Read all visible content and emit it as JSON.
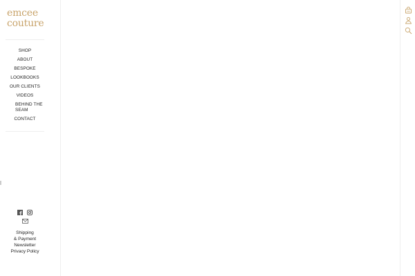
{
  "brand": {
    "line1": "emcee",
    "line2": "couture",
    "color": "#c8a36a"
  },
  "nav": {
    "items": [
      {
        "label": "SHOP"
      },
      {
        "label": "ABOUT"
      },
      {
        "label": "BESPOKE"
      },
      {
        "label": "LOOKBOOKS"
      },
      {
        "label": "OUR CLIENTS"
      },
      {
        "label": "VIDEOS"
      },
      {
        "label": "BEHIND THE SEAM"
      },
      {
        "label": "CONTACT"
      }
    ]
  },
  "social": {
    "icons": [
      "facebook-icon",
      "instagram-icon",
      "mail-icon"
    ]
  },
  "footer": {
    "links": [
      {
        "label": "Shipping"
      },
      {
        "label": "& Payment"
      },
      {
        "label": "Newsletter"
      },
      {
        "label": "Privacy Policy"
      }
    ]
  },
  "header_actions": {
    "icons": [
      "cart-icon",
      "account-icon",
      "search-icon"
    ],
    "color": "#c8a36a"
  }
}
